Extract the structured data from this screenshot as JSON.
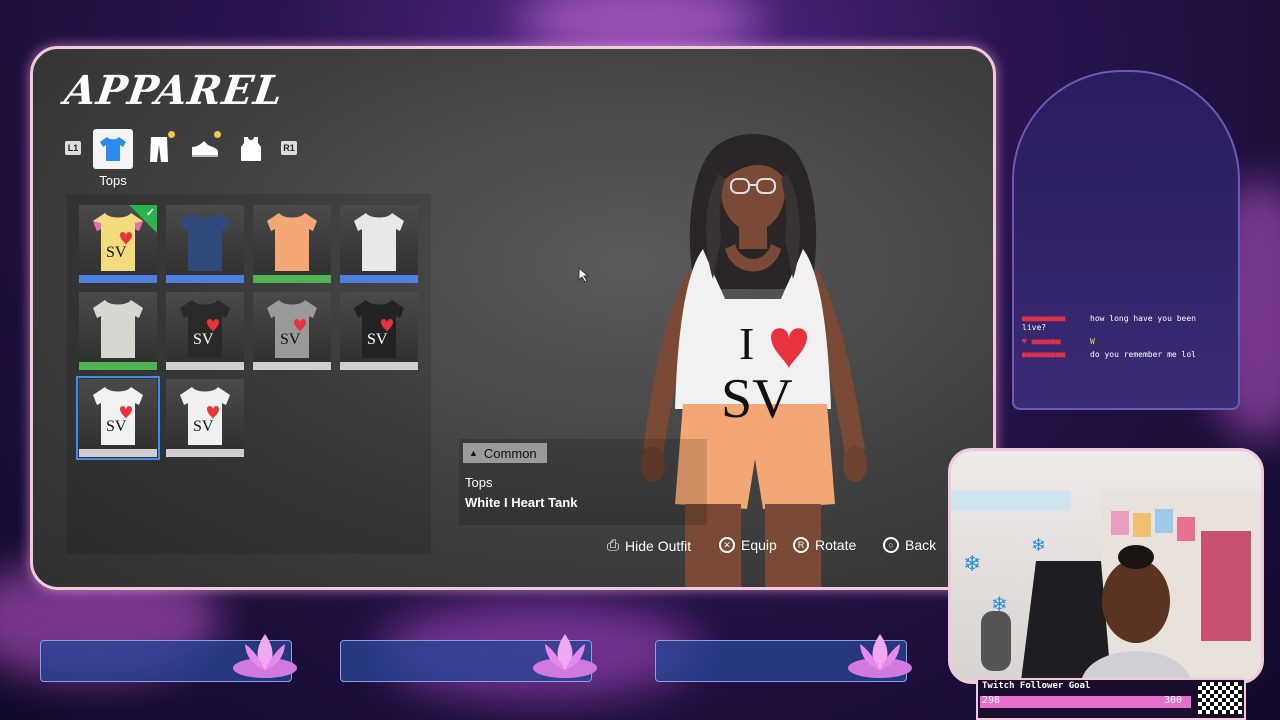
{
  "screen": {
    "title": "APPAREL",
    "shoulder_left": "L1",
    "shoulder_right": "R1",
    "tabs": [
      {
        "icon": "tshirt-icon",
        "active": true,
        "new": false
      },
      {
        "icon": "pants-icon",
        "active": false,
        "new": true
      },
      {
        "icon": "shoe-icon",
        "active": false,
        "new": true
      },
      {
        "icon": "tanktop-icon",
        "active": false,
        "new": false
      }
    ],
    "active_tab_label": "Tops"
  },
  "items": [
    {
      "name": "item-1",
      "shirt": "#f2dc7e",
      "accent": "#e86db0",
      "bar": "#4f7fe0",
      "equipped": true,
      "text": "SV"
    },
    {
      "name": "item-2",
      "shirt": "#2f4a7a",
      "bar": "#4f7fe0",
      "text": ""
    },
    {
      "name": "item-3",
      "shirt": "#f3a774",
      "bar": "#52b355",
      "text": ""
    },
    {
      "name": "item-4",
      "shirt": "#e8e8e8",
      "bar": "#4f7fe0",
      "text": ""
    },
    {
      "name": "item-5",
      "shirt": "#d8d6d0",
      "bar": "#52b355",
      "text": ""
    },
    {
      "name": "item-6",
      "shirt": "#2a2a2a",
      "bar": "#cfcfcf",
      "text": "SV"
    },
    {
      "name": "item-7",
      "shirt": "#9a9a9a",
      "bar": "#cfcfcf",
      "text": "SV"
    },
    {
      "name": "item-8",
      "shirt": "#222222",
      "bar": "#cfcfcf",
      "text": "SV"
    },
    {
      "name": "item-9",
      "shirt": "#f2f2f2",
      "bar": "#cfcfcf",
      "selected": true,
      "text": "SV"
    },
    {
      "name": "item-10",
      "shirt": "#f0f0f0",
      "bar": "#cfcfcf",
      "text": "SV"
    }
  ],
  "info": {
    "rarity": "Common",
    "category": "Tops",
    "item_name": "White I Heart Tank"
  },
  "controls": {
    "hide_outfit": "Hide Outfit",
    "equip": "Equip",
    "rotate": "Rotate",
    "back": "Back"
  },
  "character_shirt": {
    "line1": "I",
    "line2": "SV"
  },
  "chat": [
    {
      "user": "",
      "message": "how long have you been live?"
    },
    {
      "user": "",
      "message": "W"
    },
    {
      "user": "",
      "message": "do you remember me lol"
    }
  ],
  "goal": {
    "title": "Twitch Follower Goal",
    "current": "298",
    "target": "300",
    "progress_fraction": 0.993
  },
  "colors": {
    "frame": "#f0c9dd",
    "select": "#3d8ef0",
    "equipped": "#2ab34a",
    "heart": "#e8323c"
  }
}
